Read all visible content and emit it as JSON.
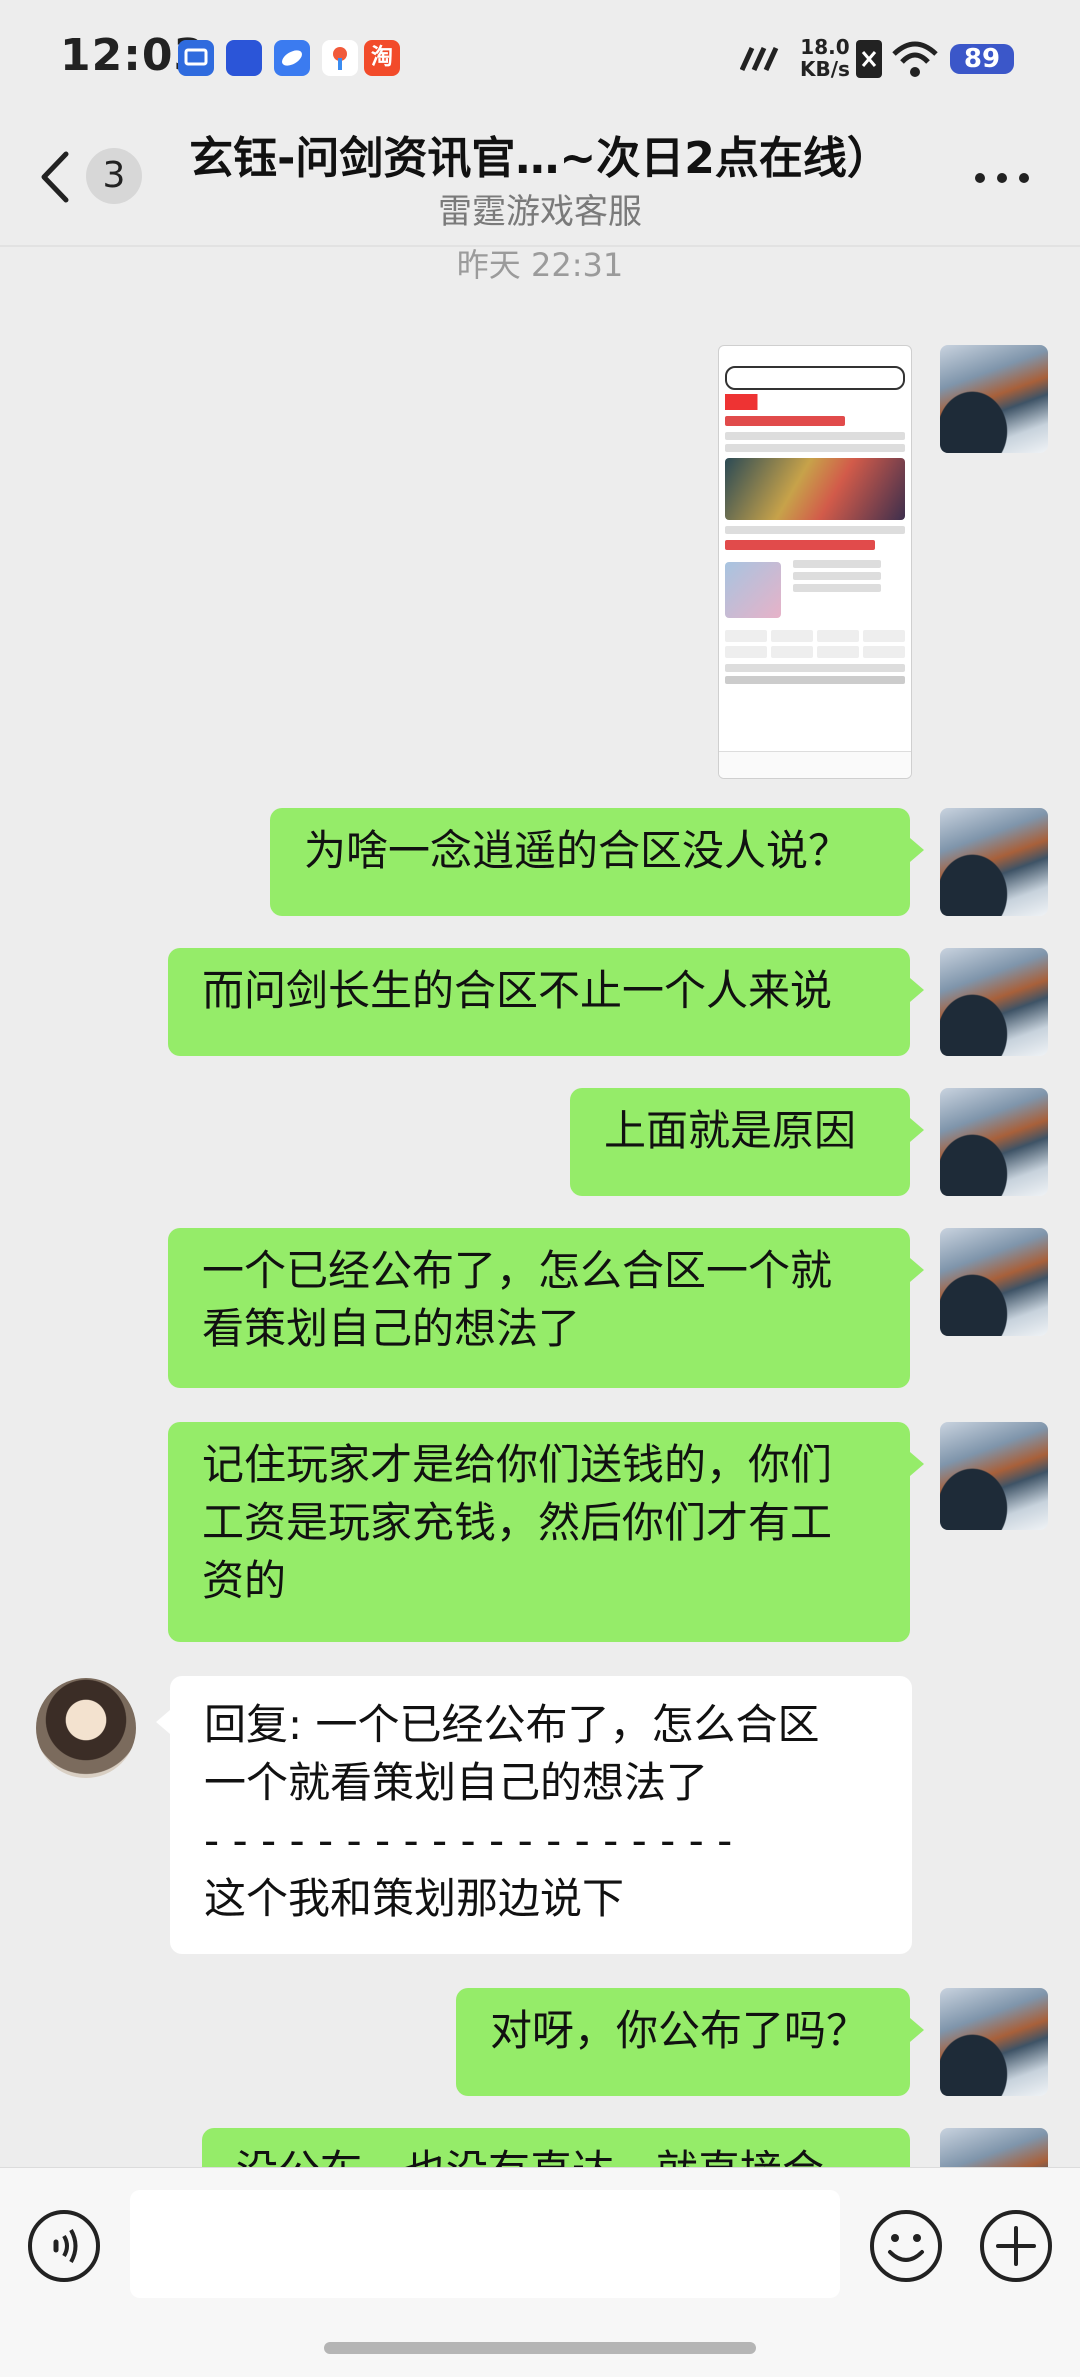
{
  "status_bar": {
    "time": "12:03",
    "network_speed_value": "18.0",
    "network_speed_unit": "KB/s",
    "battery": "89",
    "icons": [
      "cast-icon",
      "vivo-app-icon",
      "cloud-app-icon",
      "maps-icon",
      "taobao-icon",
      "signal-icon",
      "x-icon",
      "wifi-icon",
      "battery-icon"
    ]
  },
  "header": {
    "back_count": "3",
    "title": "玄钰-问剑资讯官…~次日2点在线）",
    "subtitle": "雷霆游戏客服"
  },
  "timestamp": "昨天 22:31",
  "messages": [
    {
      "id": "m1",
      "from": "me",
      "type": "image",
      "description": "screenshot-thumbnail"
    },
    {
      "id": "m2",
      "from": "me",
      "text": "为啥一念逍遥的合区没人说？"
    },
    {
      "id": "m3",
      "from": "me",
      "text": "而问剑长生的合区不止一个人来说"
    },
    {
      "id": "m4",
      "from": "me",
      "text": "上面就是原因"
    },
    {
      "id": "m5",
      "from": "me",
      "line1": "一个已经公布了，怎么合区一个就",
      "line2": "看策划自己的想法了"
    },
    {
      "id": "m6",
      "from": "me",
      "line1": "记住玩家才是给你们送钱的，你们",
      "line2": "工资是玩家充钱，然后你们才有工",
      "line3": "资的"
    },
    {
      "id": "m7",
      "from": "other",
      "line1": "回复: 一个已经公布了，怎么合区",
      "line2": "一个就看策划自己的想法了",
      "divider": "- - - - - - - - - - - - - - - - - - -",
      "line3": "这个我和策划那边说下"
    },
    {
      "id": "m8",
      "from": "me",
      "text": "对呀，你公布了吗？"
    },
    {
      "id": "m9",
      "from": "me",
      "text": "没公布，也没有直达，就直接合"
    }
  ],
  "input": {
    "placeholder": ""
  },
  "colors": {
    "my_bubble": "#95ec69",
    "their_bubble": "#ffffff",
    "background": "#ededed"
  }
}
